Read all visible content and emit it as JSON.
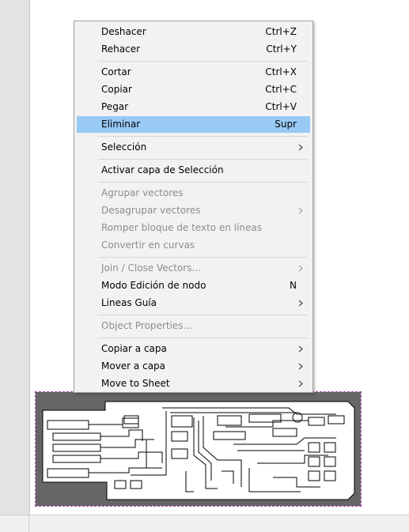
{
  "menu": {
    "items": [
      {
        "label": "Deshacer",
        "shortcut": "Ctrl+Z"
      },
      {
        "label": "Rehacer",
        "shortcut": "Ctrl+Y"
      },
      {
        "label": "Cortar",
        "shortcut": "Ctrl+X"
      },
      {
        "label": "Copiar",
        "shortcut": "Ctrl+C"
      },
      {
        "label": "Pegar",
        "shortcut": "Ctrl+V"
      },
      {
        "label": "Eliminar",
        "shortcut": "Supr",
        "highlighted": true
      },
      {
        "label": "Selección",
        "submenu": true
      },
      {
        "label": "Activar capa de Selección"
      },
      {
        "label": "Agrupar vectores",
        "disabled": true
      },
      {
        "label": "Desagrupar vectores",
        "disabled": true,
        "submenu": true
      },
      {
        "label": "Romper bloque de texto en líneas",
        "disabled": true
      },
      {
        "label": "Convertir en curvas",
        "disabled": true
      },
      {
        "label": "Join / Close Vectors...",
        "disabled": true,
        "submenu": true
      },
      {
        "label": "Modo Edición de nodo",
        "shortcut": "N"
      },
      {
        "label": "Lineas Guía",
        "submenu": true
      },
      {
        "label": "Object Properties...",
        "disabled": true
      },
      {
        "label": "Copiar a capa",
        "submenu": true
      },
      {
        "label": "Mover a capa",
        "submenu": true
      },
      {
        "label": "Move to Sheet",
        "submenu": true
      }
    ]
  },
  "colors": {
    "highlight": "#99c9f5",
    "disabled_text": "#8d8d8d",
    "board_fill": "#666666",
    "selection_border": "#b04ab0"
  },
  "icons": {
    "submenu_arrow": "chevron-right-icon"
  },
  "canvas": {
    "object": "pcb-trace-drawing"
  }
}
